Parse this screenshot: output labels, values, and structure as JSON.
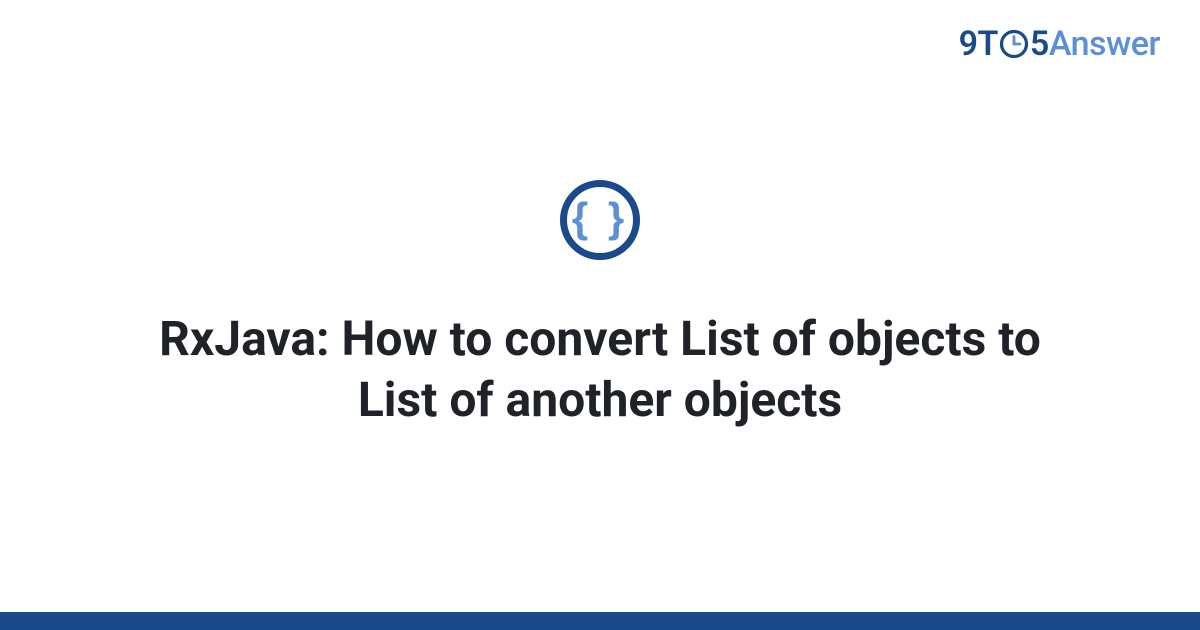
{
  "brand": {
    "part1": "9T",
    "part2": "5",
    "part3": "Answer"
  },
  "icon": {
    "glyph": "{ }"
  },
  "title": "RxJava: How to convert List of objects to List of another objects",
  "colors": {
    "primary": "#1a4a8a",
    "accent": "#5b8fd6"
  }
}
